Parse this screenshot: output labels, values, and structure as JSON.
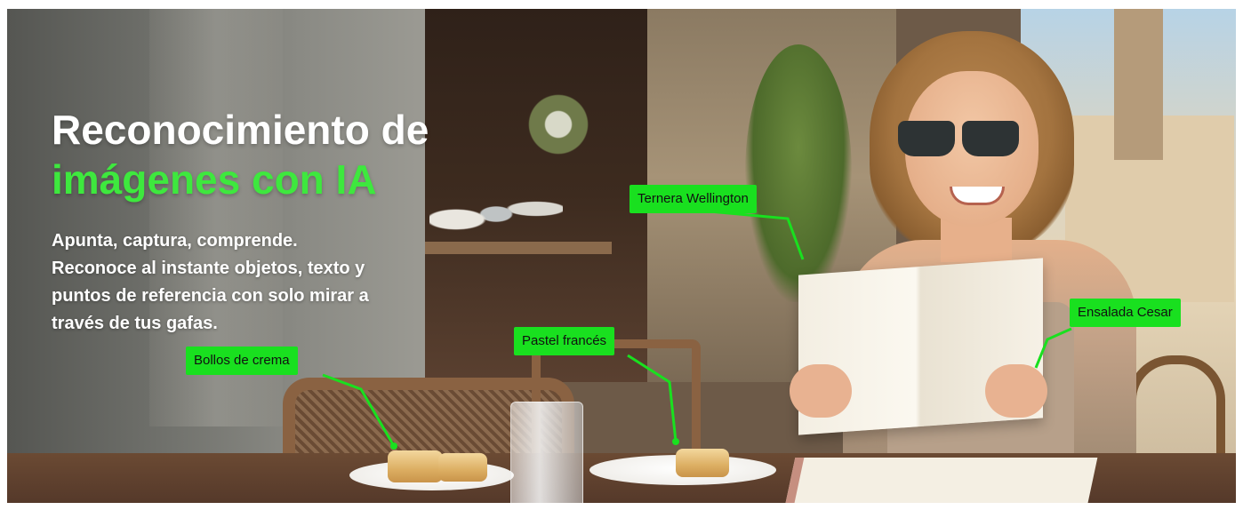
{
  "banner": {
    "headline_line1": "Reconocimiento de",
    "headline_line2": "imágenes con IA",
    "subtitle_line1": "Apunta, captura, comprende.",
    "subtitle_line2": "Reconoce al instante objetos, texto y",
    "subtitle_line3": "puntos de referencia con solo mirar a",
    "subtitle_line4": "través de tus gafas."
  },
  "callouts": {
    "cream_buns": "Bollos de crema",
    "french_pastry": "Pastel francés",
    "beef_wellington": "Ternera Wellington",
    "caesar_salad": "Ensalada Cesar"
  },
  "colors": {
    "accent_green": "#3ee83e",
    "tag_green": "#19e01f",
    "text_white": "#ffffff"
  }
}
